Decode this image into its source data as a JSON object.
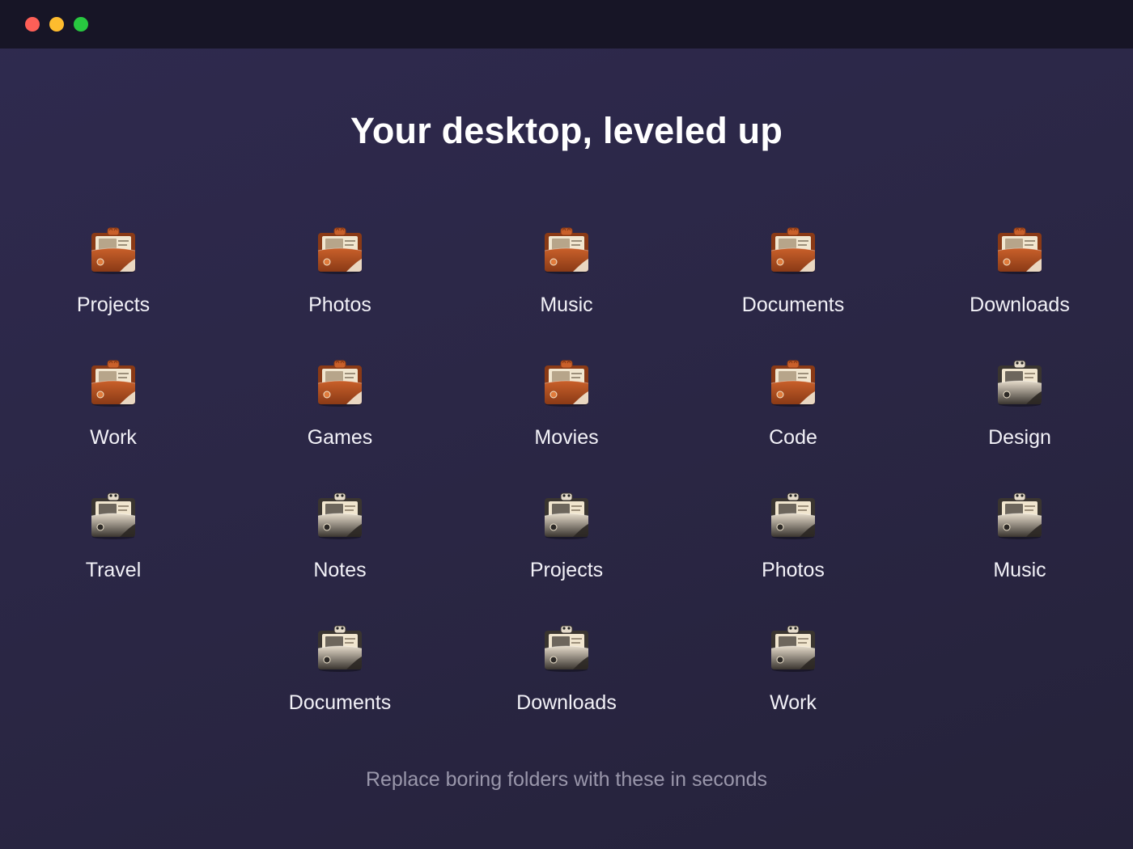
{
  "window": {
    "controls": [
      "close",
      "minimize",
      "zoom"
    ]
  },
  "headline": "Your desktop, leveled up",
  "folders": [
    {
      "label": "Projects",
      "theme": "fox"
    },
    {
      "label": "Photos",
      "theme": "fox"
    },
    {
      "label": "Music",
      "theme": "fox"
    },
    {
      "label": "Documents",
      "theme": "fox"
    },
    {
      "label": "Downloads",
      "theme": "fox"
    },
    {
      "label": "Work",
      "theme": "fox"
    },
    {
      "label": "Games",
      "theme": "fox"
    },
    {
      "label": "Movies",
      "theme": "fox"
    },
    {
      "label": "Code",
      "theme": "fox"
    },
    {
      "label": "Design",
      "theme": "panda"
    },
    {
      "label": "Travel",
      "theme": "panda"
    },
    {
      "label": "Notes",
      "theme": "panda"
    },
    {
      "label": "Projects",
      "theme": "panda"
    },
    {
      "label": "Photos",
      "theme": "panda"
    },
    {
      "label": "Music",
      "theme": "panda"
    },
    {
      "label": "Documents",
      "theme": "panda"
    },
    {
      "label": "Downloads",
      "theme": "panda"
    },
    {
      "label": "Work",
      "theme": "panda"
    }
  ],
  "tagline": "Replace boring folders with these in seconds",
  "colors": {
    "fox_folder": "#c9602a",
    "fox_folder_dark": "#8a3a16",
    "panda_folder": "#e6dccb",
    "panda_folder_dark": "#3a3530",
    "paper": "#f1e6cf",
    "background": "#2b2746",
    "titlebar": "#171526"
  }
}
